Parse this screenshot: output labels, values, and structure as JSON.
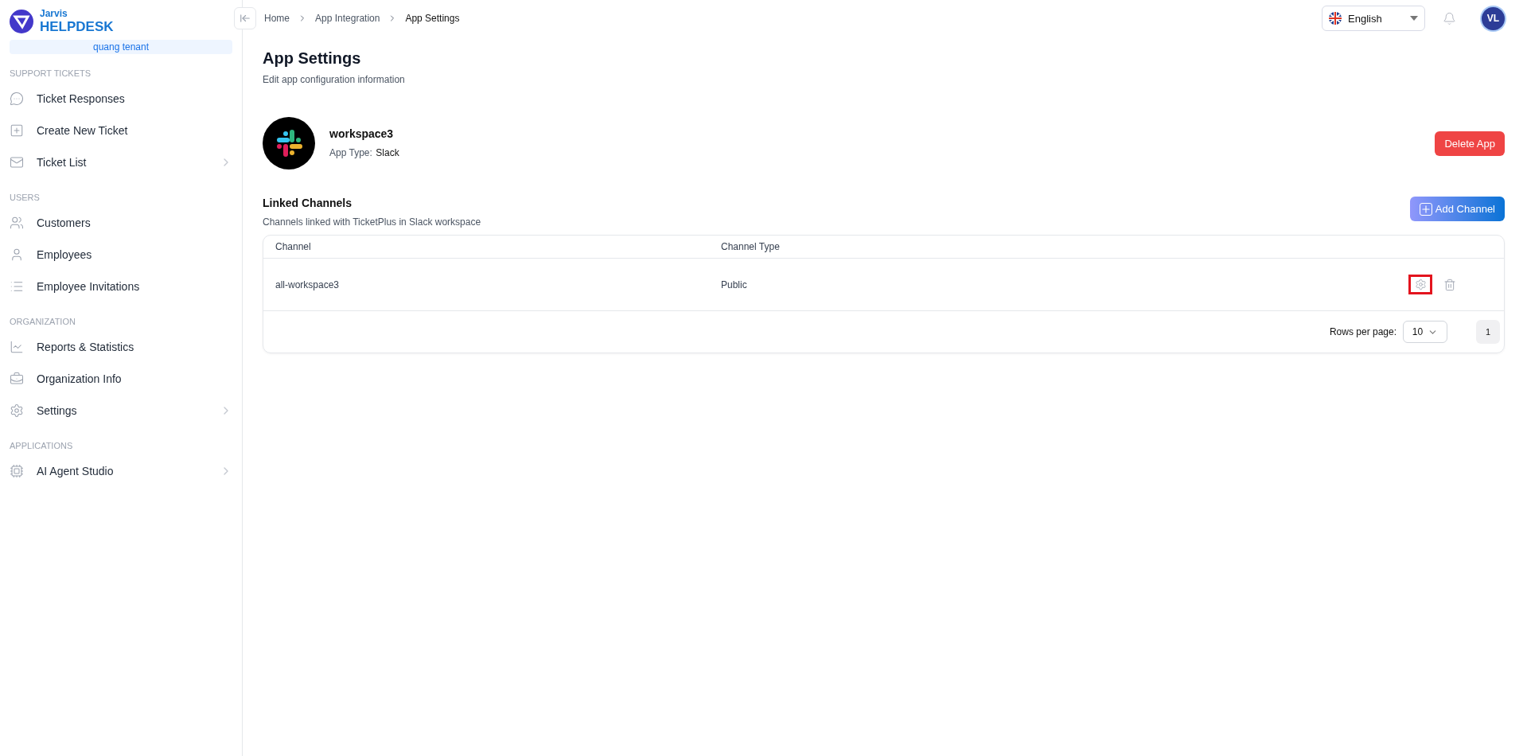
{
  "brand": {
    "top": "Jarvis",
    "name": "HELPDESK",
    "tenant": "quang tenant"
  },
  "sidebar": {
    "sections": [
      {
        "title": "SUPPORT TICKETS",
        "items": [
          {
            "label": "Ticket Responses",
            "has_children": false
          },
          {
            "label": "Create New Ticket",
            "has_children": false
          },
          {
            "label": "Ticket List",
            "has_children": true
          }
        ]
      },
      {
        "title": "USERS",
        "items": [
          {
            "label": "Customers",
            "has_children": false
          },
          {
            "label": "Employees",
            "has_children": false
          },
          {
            "label": "Employee Invitations",
            "has_children": false
          }
        ]
      },
      {
        "title": "ORGANIZATION",
        "items": [
          {
            "label": "Reports & Statistics",
            "has_children": false
          },
          {
            "label": "Organization Info",
            "has_children": false
          },
          {
            "label": "Settings",
            "has_children": true
          }
        ]
      },
      {
        "title": "APPLICATIONS",
        "items": [
          {
            "label": "AI Agent Studio",
            "has_children": true
          }
        ]
      }
    ]
  },
  "breadcrumb": [
    "Home",
    "App Integration",
    "App Settings"
  ],
  "header": {
    "language": "English",
    "avatar": "VL"
  },
  "page": {
    "title": "App Settings",
    "subtitle": "Edit app configuration information"
  },
  "app": {
    "name": "workspace3",
    "type_label": "App Type:",
    "type": "Slack",
    "delete_button": "Delete App"
  },
  "linked": {
    "title": "Linked Channels",
    "subtitle": "Channels linked with TicketPlus in Slack workspace",
    "add_button": "Add Channel"
  },
  "table": {
    "columns": [
      "Channel",
      "Channel Type"
    ],
    "rows": [
      {
        "channel": "all-workspace3",
        "type": "Public",
        "settings_highlighted": true
      }
    ],
    "rows_per_page_label": "Rows per page:",
    "rows_per_page": "10",
    "pages": [
      {
        "label": "1",
        "selected": true
      }
    ]
  }
}
